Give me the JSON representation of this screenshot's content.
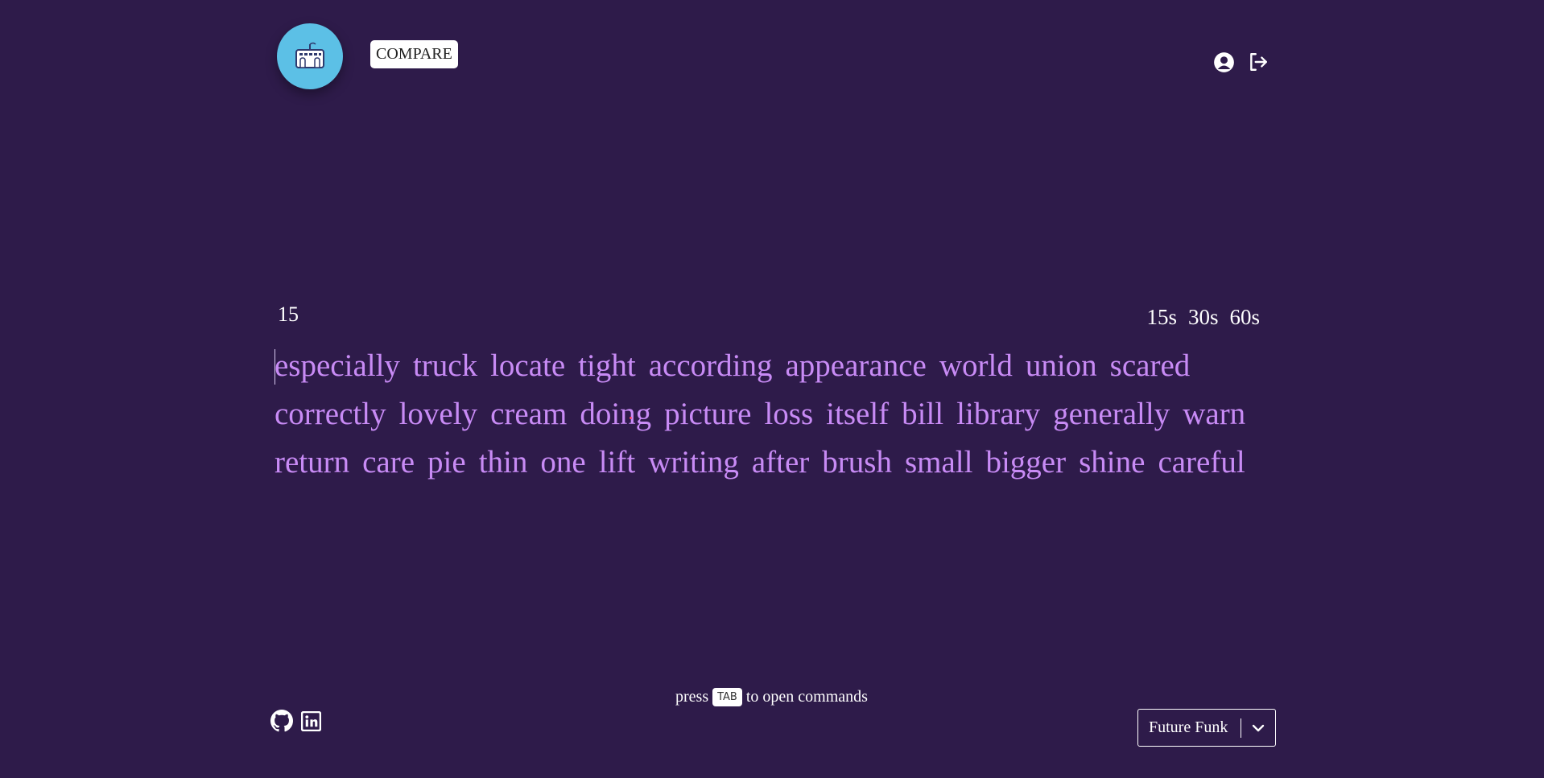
{
  "header": {
    "compare_label": "COMPARE"
  },
  "test": {
    "timer": "15",
    "time_options": [
      "15s",
      "30s",
      "60s"
    ],
    "lines": [
      [
        "especially",
        "truck",
        "locate",
        "tight",
        "according",
        "appearance",
        "world",
        "union",
        "scared"
      ],
      [
        "correctly",
        "lovely",
        "cream",
        "doing",
        "picture",
        "loss",
        "itself",
        "bill",
        "library",
        "generally",
        "warn"
      ],
      [
        "return",
        "care",
        "pie",
        "thin",
        "one",
        "lift",
        "writing",
        "after",
        "brush",
        "small",
        "bigger",
        "shine",
        "careful"
      ]
    ]
  },
  "footer": {
    "hint_before": "press",
    "hint_key": "TAB",
    "hint_after": "to open commands",
    "theme": "Future Funk"
  },
  "colors": {
    "background": "#2e1b4a",
    "words": "#c88bf5",
    "logo": "#5cc0e6"
  },
  "icons": [
    "keyboard-logo-icon",
    "account-icon",
    "logout-icon",
    "github-icon",
    "linkedin-icon",
    "chevron-down-icon"
  ]
}
